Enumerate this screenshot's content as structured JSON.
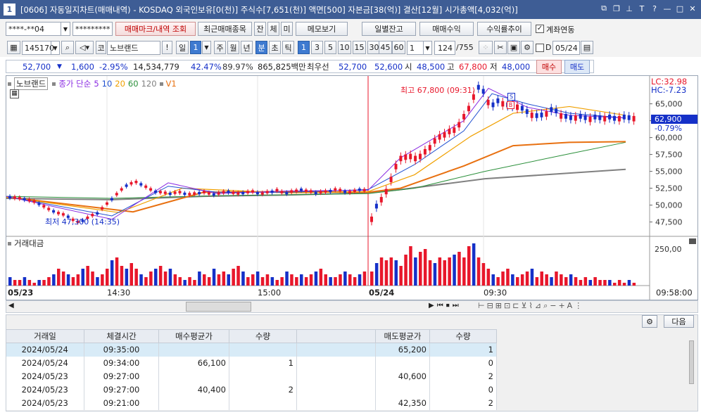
{
  "window": {
    "title": "[0606] 자동일지차트(매매내역) - KOSDAQ 외국인보유[0(천)] 주식수[7,651(천)] 액면[500] 자본금[38(억)] 결산[12월] 시가총액[4,032(억)]",
    "number": "1"
  },
  "toolbar1": {
    "account": "****-**04",
    "password": "*********",
    "btn_mark": "매매마크/내역 조회",
    "btn_recent": "최근매매종목",
    "btn_jan": "잔",
    "btn_che": "체",
    "btn_mi": "미",
    "btn_memo": "메모보기",
    "btn_daily": "일별잔고",
    "btn_profit": "매매수익",
    "btn_return": "수익률추이",
    "link_label": "계좌연동"
  },
  "toolbar2": {
    "code": "145170",
    "market": "코",
    "stock_name": "노브랜드",
    "period_day": "일",
    "day_num": "1",
    "week": "주",
    "month": "월",
    "year": "년",
    "minute": "분",
    "second": "초",
    "tick": "틱",
    "intervals": [
      "1",
      "3",
      "5",
      "10",
      "15",
      "30",
      "45",
      "60"
    ],
    "unit": "1",
    "count": "124",
    "total": "/755",
    "date_chk": "D",
    "date": "05/24"
  },
  "quote": {
    "price": "52,700",
    "arrow": "▼",
    "change": "1,600",
    "change_pct": "-2.95%",
    "volume": "14,534,779",
    "vol_pct1": "42.47%",
    "vol_pct2": "89.97%",
    "amount": "865,825백만",
    "best_label": "최우선",
    "best_ask": "52,700",
    "best_bid": "52,600",
    "open_label": "시",
    "open": "48,500",
    "high_label": "고",
    "high": "67,800",
    "low_label": "저",
    "low": "48,000",
    "buy_btn": "매수",
    "sell_btn": "매도"
  },
  "chart": {
    "legend_name": "노브랜드",
    "legend_ma": "종가 단순",
    "ma_periods": [
      "5",
      "10",
      "20",
      "60",
      "120"
    ],
    "legend_v": "V1",
    "lc": "LC:32.98",
    "hc": "HC:-7.23",
    "current_price": "62,900",
    "current_pct": "-0.79%",
    "high_note": "최고 67,800 (09:31)",
    "low_note": "최저 47,300 (14:35)",
    "y_labels": [
      "65,000",
      "62,500",
      "60,000",
      "57,500",
      "55,000",
      "52,500",
      "50,000",
      "47,500"
    ],
    "vol_title": "거래대금",
    "vol_label": "250,00",
    "x_labels": [
      "05/23",
      "14:30",
      "15:00",
      "05/24",
      "09:30"
    ],
    "x_right": "09:58:00",
    "buy_mark": "B",
    "sell_mark": "S",
    "colors": {
      "up": "#e8172b",
      "down": "#1530c8",
      "ma5": "#8a2be2",
      "ma10": "#2050d0",
      "ma20": "#f0a000",
      "ma60": "#2a8f3a",
      "ma120": "#808080",
      "ma_or": "#e87010"
    }
  },
  "chart_data": {
    "type": "candlestick",
    "xlabel": "",
    "ylabel": "",
    "ylim": [
      46000,
      68500
    ],
    "note": "intraday 1-minute candles of 노브랜드, 05/23 to 05/24",
    "high": 67800,
    "low": 47300,
    "current": 62900
  },
  "bottom": {
    "next_btn": "다음",
    "headers": [
      "거래일",
      "체결시간",
      "매수평균가",
      "수량",
      "",
      "매도평균가",
      "수량"
    ],
    "rows": [
      {
        "date": "2024/05/24",
        "time": "09:35:00",
        "buy": "",
        "bq": "",
        "sell": "65,200",
        "sq": "1"
      },
      {
        "date": "2024/05/24",
        "time": "09:34:00",
        "buy": "66,100",
        "bq": "1",
        "sell": "",
        "sq": "0"
      },
      {
        "date": "2024/05/23",
        "time": "09:27:00",
        "buy": "",
        "bq": "",
        "sell": "40,600",
        "sq": "2"
      },
      {
        "date": "2024/05/23",
        "time": "09:27:00",
        "buy": "40,400",
        "bq": "2",
        "sell": "",
        "sq": "0"
      },
      {
        "date": "2024/05/23",
        "time": "09:21:00",
        "buy": "",
        "bq": "",
        "sell": "42,350",
        "sq": "2"
      }
    ]
  }
}
